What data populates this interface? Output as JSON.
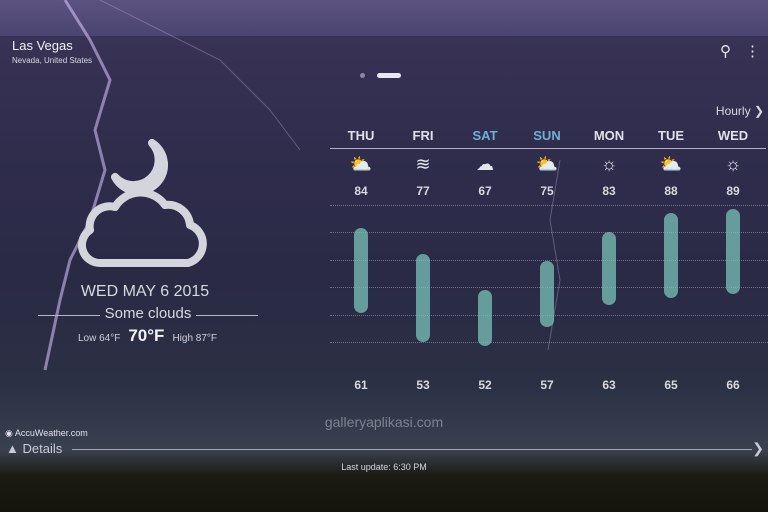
{
  "location": {
    "city": "Las Vegas",
    "region": "Nevada, United States"
  },
  "toolbar": {
    "search_icon": "search-icon",
    "menu_icon": "more-vert-icon"
  },
  "current": {
    "icon": "partly-cloudy-night-icon",
    "date": "WED MAY 6 2015",
    "condition": "Some clouds",
    "low": "Low 64°F",
    "temp": "70°F",
    "high": "High 87°F"
  },
  "forecast": {
    "hourly_label": "Hourly",
    "days": [
      {
        "day": "THU",
        "icon": "partly-sunny-icon",
        "high": 84,
        "low": 61,
        "weekend": false
      },
      {
        "day": "FRI",
        "icon": "windy-icon",
        "high": 77,
        "low": 53,
        "weekend": false
      },
      {
        "day": "SAT",
        "icon": "cloudy-icon",
        "high": 67,
        "low": 52,
        "weekend": true
      },
      {
        "day": "SUN",
        "icon": "partly-sunny-icon",
        "high": 75,
        "low": 57,
        "weekend": true
      },
      {
        "day": "MON",
        "icon": "sunny-icon",
        "high": 83,
        "low": 63,
        "weekend": false
      },
      {
        "day": "TUE",
        "icon": "partly-sunny-icon",
        "high": 88,
        "low": 65,
        "weekend": false
      },
      {
        "day": "WED",
        "icon": "sunny-icon",
        "high": 89,
        "low": 66,
        "weekend": false
      }
    ]
  },
  "colors": {
    "weekend": "#6fb0d6",
    "bar": "#7dc8be"
  },
  "footer": {
    "provider": "AccuWeather.com",
    "details": "Details",
    "last_update": "Last update: 6:30 PM",
    "watermark": "galleryaplikasi.com"
  }
}
